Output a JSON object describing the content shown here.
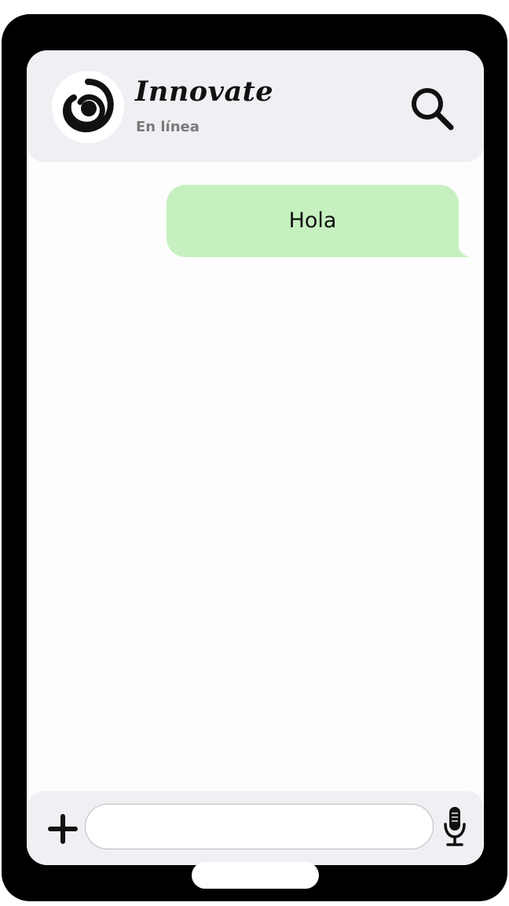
{
  "header": {
    "contact_name": "Innovate",
    "status": "En línea",
    "avatar_icon": "spiral-logo-icon",
    "search_icon": "search-icon"
  },
  "messages": [
    {
      "direction": "outgoing",
      "text": "Hola"
    }
  ],
  "composer": {
    "input_value": "",
    "input_placeholder": "",
    "attach_icon": "plus-icon",
    "mic_icon": "microphone-icon"
  },
  "colors": {
    "device": "#000000",
    "screen": "#fdfdfd",
    "bars": "#eff0f3",
    "outgoing_bubble": "#c6f0c0",
    "status_text": "#7a7a7a"
  }
}
